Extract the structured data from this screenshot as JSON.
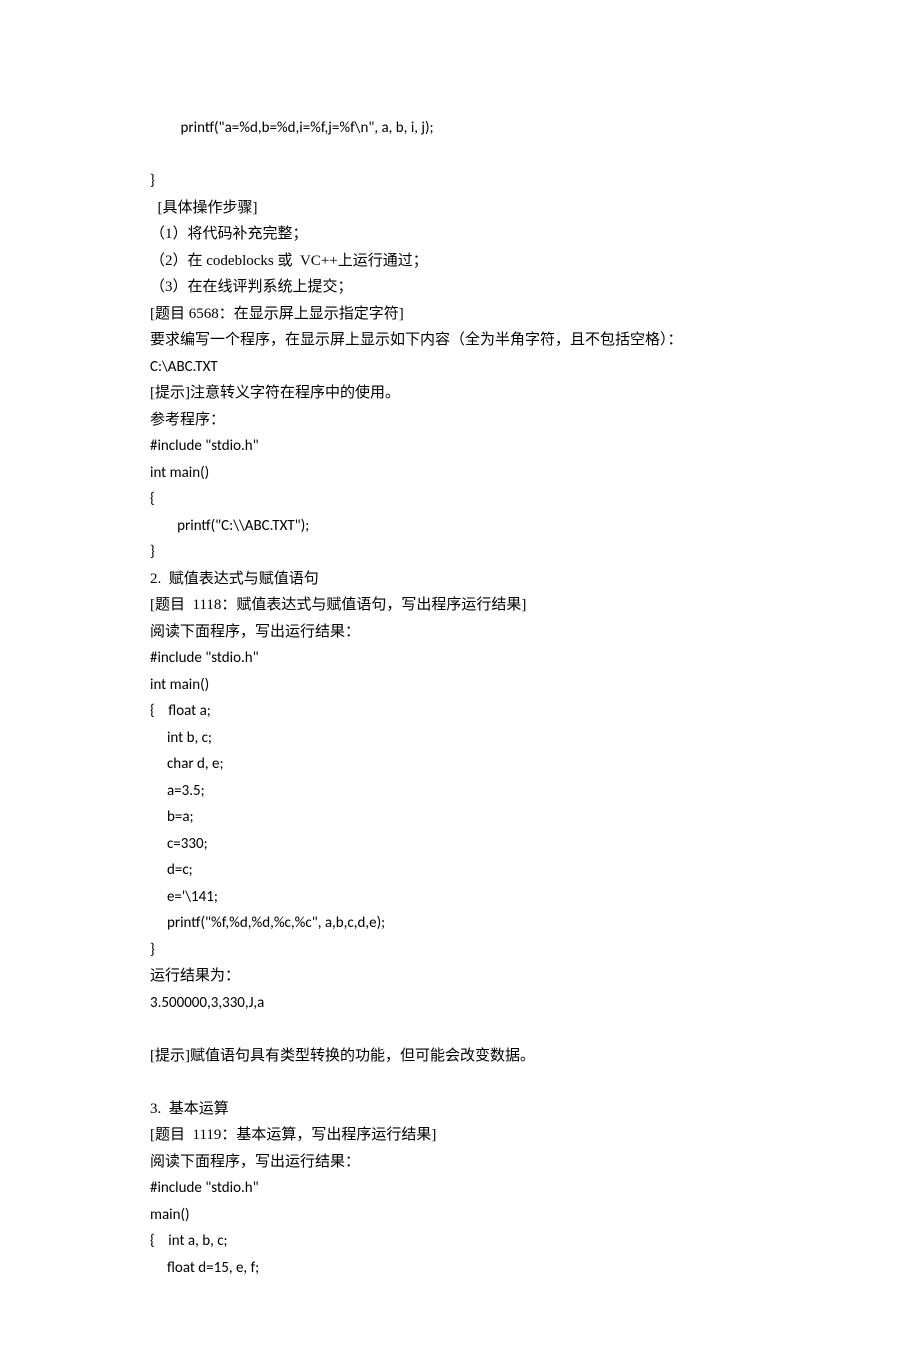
{
  "lines": [
    {
      "text": "         printf(\"a=%d,b=%d,i=%f,j=%f\\n\", a, b, i, j);",
      "cls": "code"
    },
    {
      "text": "",
      "cls": "blank"
    },
    {
      "text": "}",
      "cls": "code"
    },
    {
      "text": "  [具体操作步骤]"
    },
    {
      "text": "（1）将代码补充完整；"
    },
    {
      "text": "（2）在 codeblocks 或  VC++上运行通过；"
    },
    {
      "text": "（3）在在线评判系统上提交；"
    },
    {
      "text": "[题目 6568：在显示屏上显示指定字符]"
    },
    {
      "text": "要求编写一个程序，在显示屏上显示如下内容（全为半角字符，且不包括空格）："
    },
    {
      "text": "C:\\ABC.TXT",
      "cls": "code"
    },
    {
      "text": "[提示]注意转义字符在程序中的使用。"
    },
    {
      "text": "参考程序："
    },
    {
      "text": "#include \"stdio.h\"",
      "cls": "code"
    },
    {
      "text": "int main()",
      "cls": "code"
    },
    {
      "text": "{",
      "cls": "code"
    },
    {
      "text": "        printf(\"C:\\\\ABC.TXT\");",
      "cls": "code"
    },
    {
      "text": "}",
      "cls": "code"
    },
    {
      "text": "2.  赋值表达式与赋值语句"
    },
    {
      "text": "[题目  1118：赋值表达式与赋值语句，写出程序运行结果]"
    },
    {
      "text": "阅读下面程序，写出运行结果："
    },
    {
      "text": "#include \"stdio.h\"",
      "cls": "code"
    },
    {
      "text": "int main()",
      "cls": "code"
    },
    {
      "text": "{    float a;",
      "cls": "code"
    },
    {
      "text": "     int b, c;",
      "cls": "code"
    },
    {
      "text": "     char d, e;",
      "cls": "code"
    },
    {
      "text": "     a=3.5;",
      "cls": "code"
    },
    {
      "text": "     b=a;",
      "cls": "code"
    },
    {
      "text": "     c=330;",
      "cls": "code"
    },
    {
      "text": "     d=c;",
      "cls": "code"
    },
    {
      "text": "     e='\\141;",
      "cls": "code"
    },
    {
      "text": "     printf(\"%f,%d,%d,%c,%c\", a,b,c,d,e);",
      "cls": "code"
    },
    {
      "text": "}",
      "cls": "code"
    },
    {
      "text": "运行结果为："
    },
    {
      "text": "3.500000,3,330,J,a",
      "cls": "code"
    },
    {
      "text": "",
      "cls": "blank"
    },
    {
      "text": "[提示]赋值语句具有类型转换的功能，但可能会改变数据。"
    },
    {
      "text": "",
      "cls": "blank"
    },
    {
      "text": "3.  基本运算"
    },
    {
      "text": "[题目  1119：基本运算，写出程序运行结果]"
    },
    {
      "text": "阅读下面程序，写出运行结果："
    },
    {
      "text": "#include \"stdio.h\"",
      "cls": "code"
    },
    {
      "text": "main()",
      "cls": "code"
    },
    {
      "text": "{    int a, b, c;",
      "cls": "code"
    },
    {
      "text": "     float d=15, e, f;",
      "cls": "code"
    }
  ]
}
